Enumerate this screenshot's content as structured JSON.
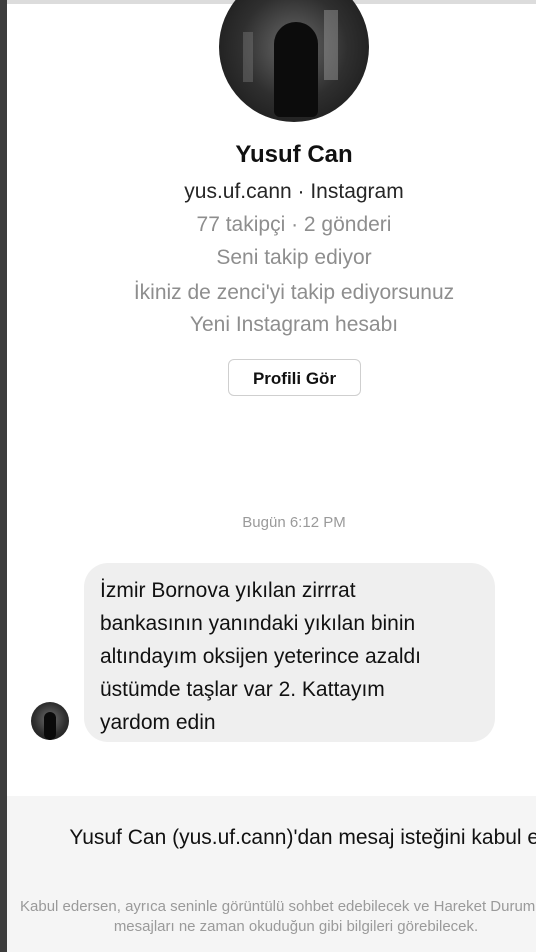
{
  "profile": {
    "name": "Yusuf Can",
    "handle_line": "yus.uf.cann · Instagram",
    "stats_line": "77 takipçi · 2 gönderi",
    "follow_status": "Seni takip ediyor",
    "mutual_line": "İkiniz de zenci'yi takip ediyorsunuz",
    "account_note": "Yeni Instagram hesabı",
    "view_profile_label": "Profili Gör"
  },
  "conversation": {
    "timestamp": "Bugün 6:12 PM",
    "message_text": "İzmir Bornova yıkılan zirrrat\nbankasının yanındaki yıkılan binin\naltındayım oksijen yeterince azaldı\nüstümde taşlar var 2. Kattayım\nyardom edin"
  },
  "request": {
    "title": "Yusuf Can (yus.uf.cann)'dan mesaj isteğini kabul et?",
    "description": "Kabul edersen, ayrıca seninle görüntülü sohbet edebilecek ve Hareket Durumun ve mesajları ne zaman okuduğun gibi bilgileri görebilecek."
  }
}
